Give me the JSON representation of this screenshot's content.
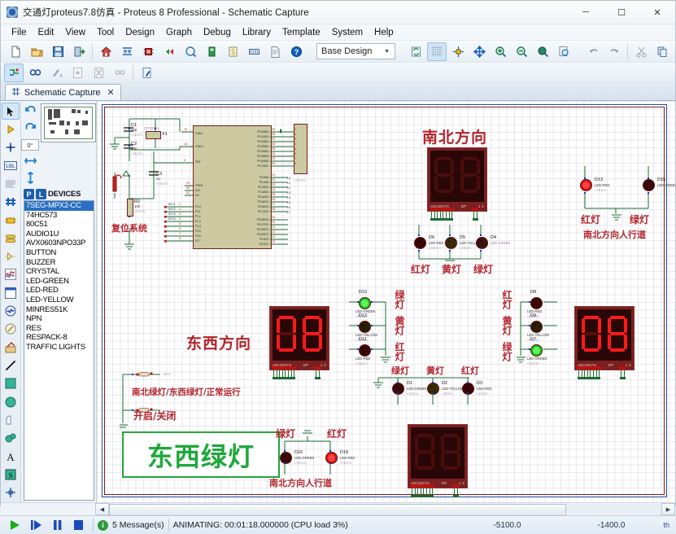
{
  "window": {
    "title": "交通灯proteus7.8仿真 - Proteus 8 Professional - Schematic Capture",
    "app_icon": "proteus-icon",
    "minimize": "─",
    "maximize": "☐",
    "close": "✕"
  },
  "menu": [
    "File",
    "Edit",
    "View",
    "Tool",
    "Design",
    "Graph",
    "Debug",
    "Library",
    "Template",
    "System",
    "Help"
  ],
  "toolbar": {
    "design_selector": "Base Design",
    "row1_icons": [
      "new-file-icon",
      "open-folder-icon",
      "save-icon",
      "export-icon",
      "home-icon",
      "pcb-layout-icon",
      "ic-design-icon",
      "back-nav-icon",
      "3d-view-icon",
      "bill-of-materials-icon",
      "currency-icon",
      "oled-icon",
      "report-icon",
      "help-icon"
    ],
    "row1b_icons": [
      "refresh-icon",
      "grid-toggle-icon",
      "origin-icon",
      "pan-icon",
      "zoom-in-icon",
      "zoom-out-icon",
      "zoom-area-icon",
      "zoom-sheet-icon",
      "undo-icon",
      "redo-icon",
      "cut-icon",
      "copy-icon",
      "paste-icon",
      "block-copy-icon",
      "block-move-icon",
      "block-rotate-icon",
      "block-delete-icon",
      "pick-device-icon",
      "make-device-icon",
      "packaging-tool-icon",
      "decompose-icon"
    ],
    "row2_icons": [
      "wire-autorouter-icon",
      "search-tag-icon",
      "property-assignment-icon",
      "new-sheet-icon",
      "remove-sheet-icon",
      "zoom-sheet2-icon",
      "edit-design-icon"
    ]
  },
  "tab": {
    "label": "Schematic Capture",
    "icon": "schematic-icon",
    "close": "✕"
  },
  "left_tools": [
    "selection-mode-icon",
    "component-mode-icon",
    "junction-dot-icon",
    "wire-label-icon",
    "text-script-icon",
    "buses-icon",
    "subcircuit-icon",
    "terminals-icon",
    "device-pins-icon",
    "graph-mode-icon",
    "tape-recorder-icon",
    "generator-icon",
    "voltage-probe-icon",
    "current-probe-icon",
    "virtual-instrument-icon",
    "line-icon",
    "box-icon",
    "circle-icon",
    "arc-icon",
    "path-icon",
    "text-icon",
    "symbol-icon",
    "marker-icon"
  ],
  "rotation": {
    "cw_icon": "rotate-cw-icon",
    "ccw_icon": "rotate-ccw-icon",
    "angle": "0°",
    "mirror_x_icon": "mirror-horizontal-icon",
    "mirror_y_icon": "mirror-vertical-icon"
  },
  "picker": {
    "p_label": "P",
    "l_label": "L",
    "title": "DEVICES"
  },
  "devices": [
    "7SEG-MPX2-CC",
    "74HC573",
    "80C51",
    "AUDIO1U",
    "AVX0603NPO33P",
    "BUTTON",
    "BUZZER",
    "CRYSTAL",
    "LED-GREEN",
    "LED-RED",
    "LED-YELLOW",
    "MINRES51K",
    "NPN",
    "RES",
    "RESPACK-8",
    "TRAFFIC LIGHTS"
  ],
  "selected_device": "7SEG-MPX2-CC",
  "status": {
    "play_icon": "play-icon",
    "step_icon": "step-icon",
    "pause_icon": "pause-icon",
    "stop_icon": "stop-icon",
    "info_icon": "info-icon",
    "messages": "5 Message(s)",
    "animating": "ANIMATING: 00:01:18.000000 (CPU load 3%)",
    "coord_x": "-5100.0",
    "coord_y": "-1400.0",
    "units": "th"
  },
  "schematic": {
    "headings": {
      "north_south": "南北方向",
      "east_west": "东西方向"
    },
    "annotations": {
      "reset_system": "复位系统",
      "ns_red": "红灯",
      "ns_green": "绿灯",
      "ns_crosswalk": "南北方向人行道",
      "ns_lights": [
        "红灯",
        "黄灯",
        "绿灯"
      ],
      "ew_lights_vertical": [
        "绿灯",
        "黄灯",
        "红灯"
      ],
      "right_lights_vertical": [
        "红灯",
        "黄灯",
        "绿灯"
      ],
      "mid_lights": [
        "绿灯",
        "黄灯",
        "红灯"
      ],
      "switch1": "南北绿灯/东西绿灯/正常运行",
      "switch2": "开启/关闭",
      "banner": "东西绿灯",
      "cross_green": "绿灯",
      "cross_red": "红灯",
      "ns_crosswalk2": "南北方向人行道"
    },
    "mcu": {
      "left_pins": [
        "XTAL1",
        "XTAL2",
        "RST",
        "PSEN",
        "ALE",
        "EA"
      ],
      "port1": [
        "P1.0",
        "P1.1",
        "P1.2",
        "P1.3",
        "P1.4",
        "P1.5",
        "P1.6",
        "P1.7"
      ],
      "port0": [
        "P0.0/AD0",
        "P0.1/AD1",
        "P0.2/AD2",
        "P0.3/AD3",
        "P0.4/AD4",
        "P0.5/AD5",
        "P0.6/AD6",
        "P0.7/AD7"
      ],
      "port2": [
        "P2.0/A8",
        "P2.1/A9",
        "P2.2/A10",
        "P2.3/A11",
        "P2.4/A12",
        "P2.5/A13",
        "P2.6/A14",
        "P2.7/A15"
      ],
      "port3": [
        "P3.0/RXD",
        "P3.1/TXD",
        "P3.2/INT0",
        "P3.3/INT1",
        "P3.4/T0",
        "P3.5/T1",
        "P3.6/WR",
        "P3.7/RD"
      ]
    },
    "parts": {
      "c1": "C1",
      "c1v": "30p",
      "c2": "C2",
      "c2v": "30p",
      "c3": "C3",
      "c3v": "1u",
      "x1": "X1",
      "x1v": "CRYSTAL",
      "r2": "R2",
      "r2v": "100",
      "text_placeholder": "<TEXT>"
    },
    "leds": [
      {
        "id": "D13",
        "type": "LED-RED"
      },
      {
        "id": "D15",
        "type": "LED-GREEN"
      },
      {
        "id": "D6",
        "type": "LED-RED"
      },
      {
        "id": "D5",
        "type": "LED-YELLOW"
      },
      {
        "id": "D4",
        "type": "LED-GREEN"
      },
      {
        "id": "D10",
        "type": "LED-GREEN"
      },
      {
        "id": "D12",
        "type": "LED-YELLOW"
      },
      {
        "id": "D11",
        "type": "LED-RED"
      },
      {
        "id": "D8",
        "type": "LED-RED"
      },
      {
        "id": "D9",
        "type": "LED-YELLOW"
      },
      {
        "id": "D7",
        "type": "LED-GREEN"
      },
      {
        "id": "D1",
        "type": "LED-GREEN"
      },
      {
        "id": "D2",
        "type": "LED-YELLOW"
      },
      {
        "id": "D3",
        "type": "LED-RED"
      },
      {
        "id": "D16",
        "type": "LED-GREEN"
      },
      {
        "id": "D18",
        "type": "LED-RED"
      }
    ],
    "displays": [
      {
        "name": "ns-display",
        "value": "88",
        "lit": false,
        "caps_left": "ABCDEFG",
        "caps_mid": "DP",
        "caps_right": "1 2"
      },
      {
        "name": "ew-display",
        "value": "08",
        "lit": true,
        "caps_left": "ABCDEFG",
        "caps_mid": "DP",
        "caps_right": "1 2"
      },
      {
        "name": "right-display",
        "value": "08",
        "lit": true,
        "caps_left": "ABCDEFG",
        "caps_mid": "DP",
        "caps_right": "1 2"
      },
      {
        "name": "bottom-display",
        "value": "88",
        "lit": false,
        "caps_left": "ABCDEFG",
        "caps_mid": "DP",
        "caps_right": "1 2"
      }
    ],
    "colors": {
      "wire": "#1f6b33",
      "chinese_red": "#b3242b",
      "banner_green": "#1fa83c",
      "led_red_on": "#e01010",
      "led_red_off": "#4a0000",
      "led_green_on": "#18c21a",
      "seg_on": "#ff1a1a",
      "seg_off": "#4a0d0d"
    }
  }
}
